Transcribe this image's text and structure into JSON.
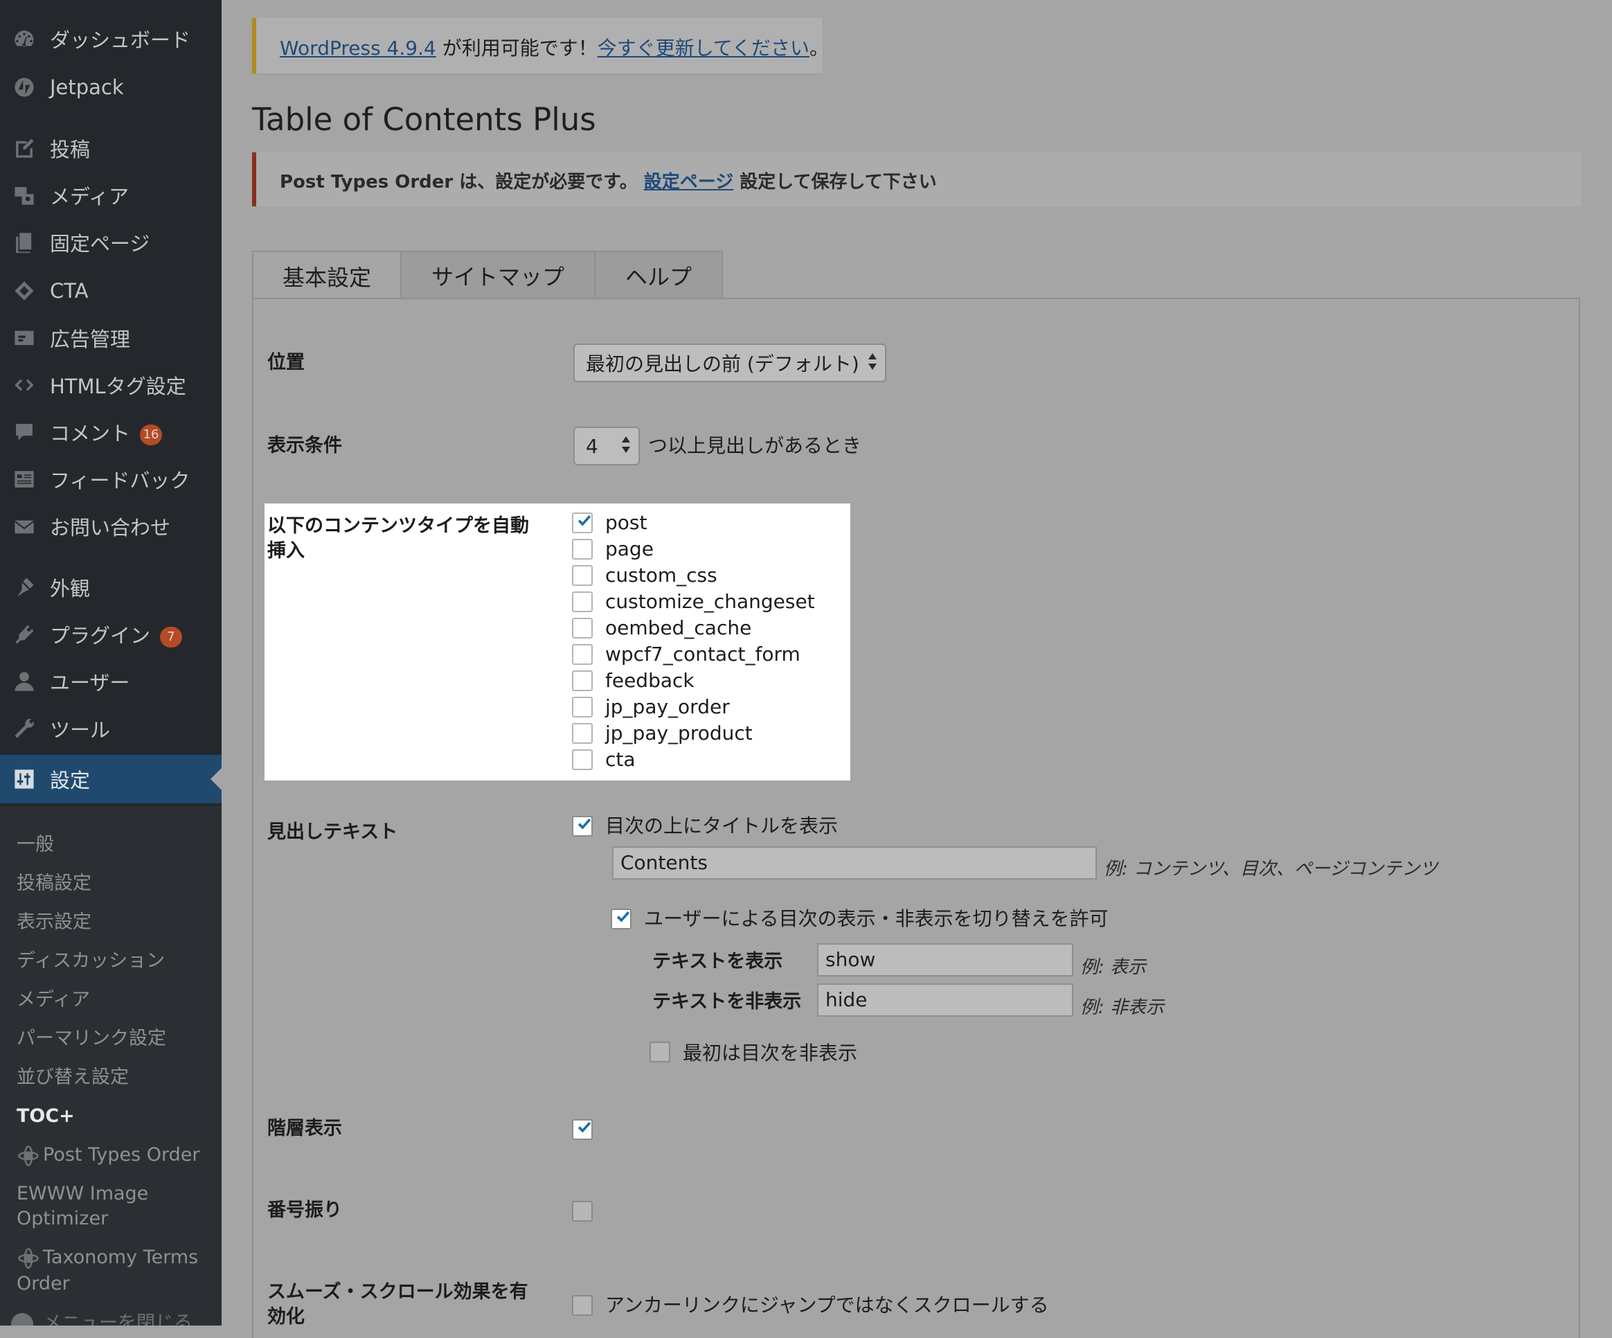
{
  "sidebar": {
    "items": [
      {
        "label": "ダッシュボード",
        "icon": "dashboard-icon"
      },
      {
        "label": "Jetpack",
        "icon": "jetpack-icon"
      },
      {
        "label": "投稿",
        "icon": "post-edit-icon"
      },
      {
        "label": "メディア",
        "icon": "media-icon"
      },
      {
        "label": "固定ページ",
        "icon": "pages-icon"
      },
      {
        "label": "CTA",
        "icon": "cta-icon"
      },
      {
        "label": "広告管理",
        "icon": "ads-icon"
      },
      {
        "label": "HTMLタグ設定",
        "icon": "code-icon"
      },
      {
        "label": "コメント",
        "icon": "comment-icon",
        "badge": "16"
      },
      {
        "label": "フィードバック",
        "icon": "feedback-icon"
      },
      {
        "label": "お問い合わせ",
        "icon": "mail-icon"
      },
      {
        "label": "外観",
        "icon": "appearance-icon"
      },
      {
        "label": "プラグイン",
        "icon": "plugin-icon",
        "badge": "7"
      },
      {
        "label": "ユーザー",
        "icon": "user-icon"
      },
      {
        "label": "ツール",
        "icon": "tools-icon"
      },
      {
        "label": "設定",
        "icon": "settings-icon",
        "active": true
      }
    ],
    "submenu": [
      "一般",
      "投稿設定",
      "表示設定",
      "ディスカッション",
      "メディア",
      "パーマリンク設定",
      "並び替え設定",
      "TOC+",
      "Post Types Order",
      "EWWW Image",
      "Optimizer",
      "Taxonomy Terms",
      "Order"
    ],
    "collapse_label": "メニューを閉じる"
  },
  "notices": {
    "update": {
      "link1": "WordPress 4.9.4",
      "text": " が利用可能です！",
      "link2": "今すぐ更新してください",
      "end": "。"
    },
    "error": {
      "text1": "Post Types Order は、設定が必要です。 ",
      "link": "設定ページ",
      "text2": " 設定して保存して下さい"
    }
  },
  "page": {
    "title": "Table of Contents Plus",
    "tabs": [
      "基本設定",
      "サイトマップ",
      "ヘルプ"
    ]
  },
  "settings": {
    "position": {
      "label": "位置",
      "value": "最初の見出しの前 (デフォルト)"
    },
    "show_when": {
      "label": "表示条件",
      "value": "4",
      "suffix": "つ以上見出しがあるとき"
    },
    "auto_insert": {
      "label_line1": "以下のコンテンツタイプを自動",
      "label_line2": "挿入",
      "types": [
        {
          "name": "post",
          "checked": true
        },
        {
          "name": "page",
          "checked": false
        },
        {
          "name": "custom_css",
          "checked": false
        },
        {
          "name": "customize_changeset",
          "checked": false
        },
        {
          "name": "oembed_cache",
          "checked": false
        },
        {
          "name": "wpcf7_contact_form",
          "checked": false
        },
        {
          "name": "feedback",
          "checked": false
        },
        {
          "name": "jp_pay_order",
          "checked": false
        },
        {
          "name": "jp_pay_product",
          "checked": false
        },
        {
          "name": "cta",
          "checked": false
        }
      ]
    },
    "heading_text": {
      "label": "見出しテキスト",
      "show_title_label": "目次の上にタイトルを表示",
      "show_title_checked": true,
      "title_value": "Contents",
      "title_hint": "例: コンテンツ、目次、ページコンテンツ",
      "toggle_label": "ユーザーによる目次の表示・非表示を切り替えを許可",
      "toggle_checked": true,
      "show_text_label": "テキストを表示",
      "show_text_value": "show",
      "show_text_hint": "例: 表示",
      "hide_text_label": "テキストを非表示",
      "hide_text_value": "hide",
      "hide_text_hint": "例: 非表示",
      "initially_hidden_label": "最初は目次を非表示",
      "initially_hidden_checked": false
    },
    "hierarchy": {
      "label": "階層表示",
      "checked": true
    },
    "numbering": {
      "label": "番号振り",
      "checked": false
    },
    "smooth_scroll": {
      "label_line1": "スムーズ・スクロール効果を有",
      "label_line2": "効化",
      "option_label": "アンカーリンクにジャンプではなくスクロールする",
      "checked": false
    }
  }
}
